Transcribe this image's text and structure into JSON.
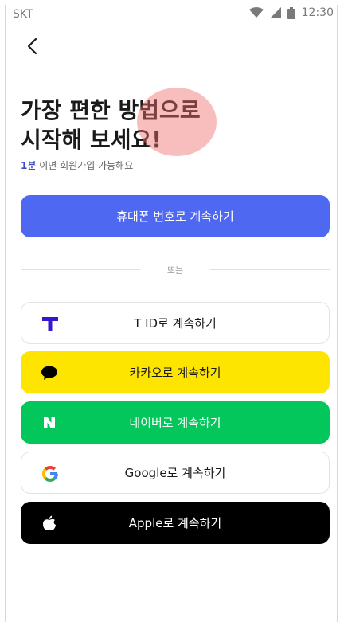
{
  "status_bar": {
    "carrier": "SKT",
    "time": "12:30"
  },
  "title": {
    "line1": "가장 편한 방법으로",
    "line2": "시작해 보세요!"
  },
  "subtitle": {
    "highlight": "1분",
    "rest": " 이면 회원가입 가능해요"
  },
  "buttons": {
    "phone": "휴대폰 번호로 계속하기",
    "tid": "T ID로 계속하기",
    "kakao": "카카오로 계속하기",
    "naver": "네이버로 계속하기",
    "google": "Google로 계속하기",
    "apple": "Apple로 계속하기"
  },
  "divider_label": "또는",
  "colors": {
    "primary": "#4f68f1",
    "kakao": "#fee500",
    "naver": "#03c75a",
    "apple": "#000000",
    "tid": "#3617ce"
  }
}
